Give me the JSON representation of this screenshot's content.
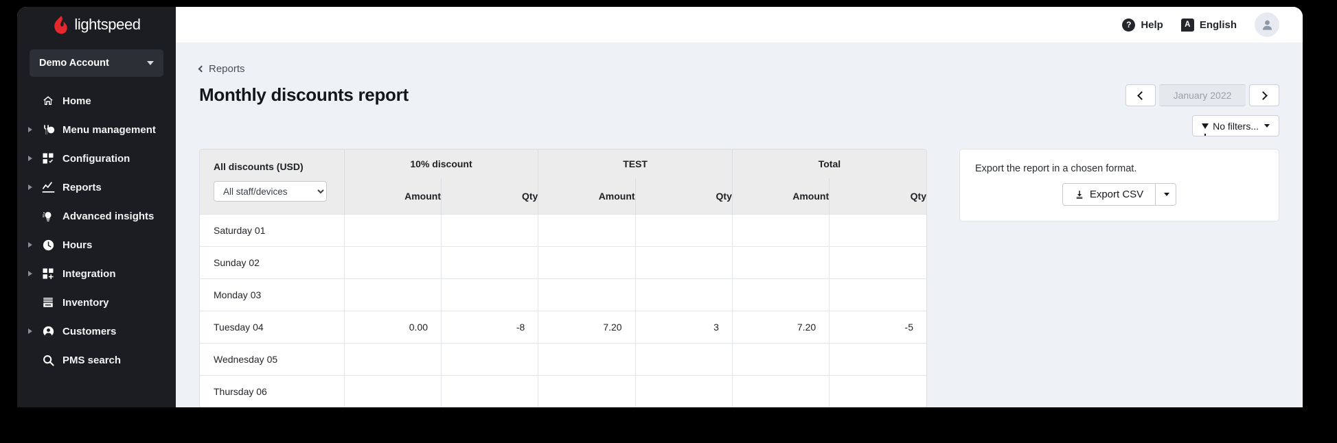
{
  "brand": {
    "name": "lightspeed"
  },
  "account": {
    "label": "Demo Account"
  },
  "sidebar": {
    "items": [
      {
        "label": "Home",
        "icon": "home-icon",
        "expandable": false
      },
      {
        "label": "Menu management",
        "icon": "menu-management-icon",
        "expandable": true
      },
      {
        "label": "Configuration",
        "icon": "configuration-icon",
        "expandable": true
      },
      {
        "label": "Reports",
        "icon": "reports-chart-icon",
        "expandable": true
      },
      {
        "label": "Advanced insights",
        "icon": "lightbulb-icon",
        "expandable": false
      },
      {
        "label": "Hours",
        "icon": "clock-icon",
        "expandable": true
      },
      {
        "label": "Integration",
        "icon": "integration-icon",
        "expandable": true
      },
      {
        "label": "Inventory",
        "icon": "inventory-box-icon",
        "expandable": false
      },
      {
        "label": "Customers",
        "icon": "person-circle-icon",
        "expandable": true
      },
      {
        "label": "PMS search",
        "icon": "search-icon",
        "expandable": false
      }
    ]
  },
  "topbar": {
    "help_label": "Help",
    "help_glyph": "?",
    "language_label": "English",
    "language_glyph": "A",
    "avatar_icon": "user-avatar-icon"
  },
  "breadcrumb": {
    "label": "Reports"
  },
  "page": {
    "title": "Monthly discounts report"
  },
  "date_nav": {
    "prev_icon": "chevron-left-icon",
    "next_icon": "chevron-right-icon",
    "current": "January 2022"
  },
  "filters": {
    "label": "No filters...",
    "icon": "funnel-icon"
  },
  "table": {
    "row_header_title": "All discounts (USD)",
    "staff_select": {
      "value": "All staff/devices",
      "options": [
        "All staff/devices"
      ]
    },
    "groups": [
      {
        "label": "10% discount",
        "columns": [
          "Amount",
          "Qty"
        ]
      },
      {
        "label": "TEST",
        "columns": [
          "Amount",
          "Qty"
        ]
      },
      {
        "label": "Total",
        "columns": [
          "Amount",
          "Qty"
        ]
      }
    ],
    "rows": [
      {
        "day": "Saturday 01",
        "cells": [
          "",
          "",
          "",
          "",
          "",
          ""
        ]
      },
      {
        "day": "Sunday 02",
        "cells": [
          "",
          "",
          "",
          "",
          "",
          ""
        ]
      },
      {
        "day": "Monday 03",
        "cells": [
          "",
          "",
          "",
          "",
          "",
          ""
        ]
      },
      {
        "day": "Tuesday 04",
        "cells": [
          "0.00",
          "-8",
          "7.20",
          "3",
          "7.20",
          "-5"
        ]
      },
      {
        "day": "Wednesday 05",
        "cells": [
          "",
          "",
          "",
          "",
          "",
          ""
        ]
      },
      {
        "day": "Thursday 06",
        "cells": [
          "",
          "",
          "",
          "",
          "",
          ""
        ]
      }
    ]
  },
  "export": {
    "description": "Export the report in a chosen format.",
    "button_label": "Export CSV",
    "button_icon": "download-icon",
    "split_icon": "caret-down-icon"
  },
  "colors": {
    "sidebar_bg": "#1b1d22",
    "brand_red": "#e4282e",
    "canvas_bg": "#eef1f6",
    "table_header_bg": "#ececec"
  }
}
